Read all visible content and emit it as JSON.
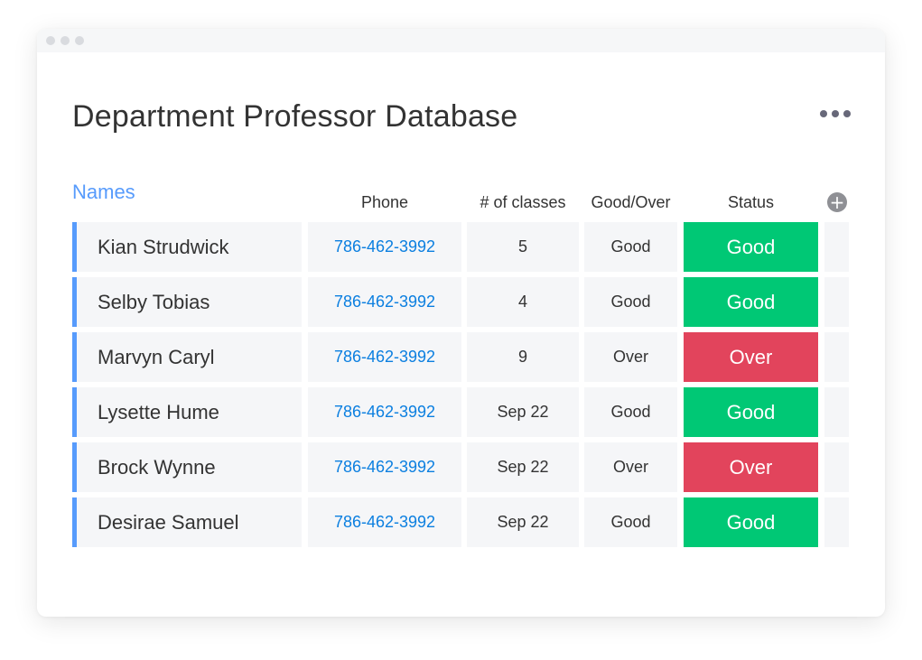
{
  "title": "Department Professor Database",
  "group": {
    "label": "Names",
    "color": "#579bfc"
  },
  "columns": {
    "phone": "Phone",
    "classes": "# of classes",
    "goodover": "Good/Over",
    "status": "Status"
  },
  "colors": {
    "good": "#00c875",
    "over": "#e2445c",
    "link": "#0b7fe0"
  },
  "rows": [
    {
      "name": "Kian  Strudwick",
      "phone": "786-462-3992",
      "classes": "5",
      "goodover": "Good",
      "status": "Good",
      "status_key": "good"
    },
    {
      "name": "Selby Tobias",
      "phone": "786-462-3992",
      "classes": "4",
      "goodover": "Good",
      "status": "Good",
      "status_key": "good"
    },
    {
      "name": "Marvyn Caryl",
      "phone": "786-462-3992",
      "classes": "9",
      "goodover": "Over",
      "status": "Over",
      "status_key": "over"
    },
    {
      "name": "Lysette  Hume",
      "phone": "786-462-3992",
      "classes": "Sep 22",
      "goodover": "Good",
      "status": "Good",
      "status_key": "good"
    },
    {
      "name": " Brock Wynne",
      "phone": "786-462-3992",
      "classes": "Sep 22",
      "goodover": "Over",
      "status": "Over",
      "status_key": "over"
    },
    {
      "name": "Desirae Samuel",
      "phone": "786-462-3992",
      "classes": "Sep 22",
      "goodover": "Good",
      "status": "Good",
      "status_key": "good"
    }
  ]
}
